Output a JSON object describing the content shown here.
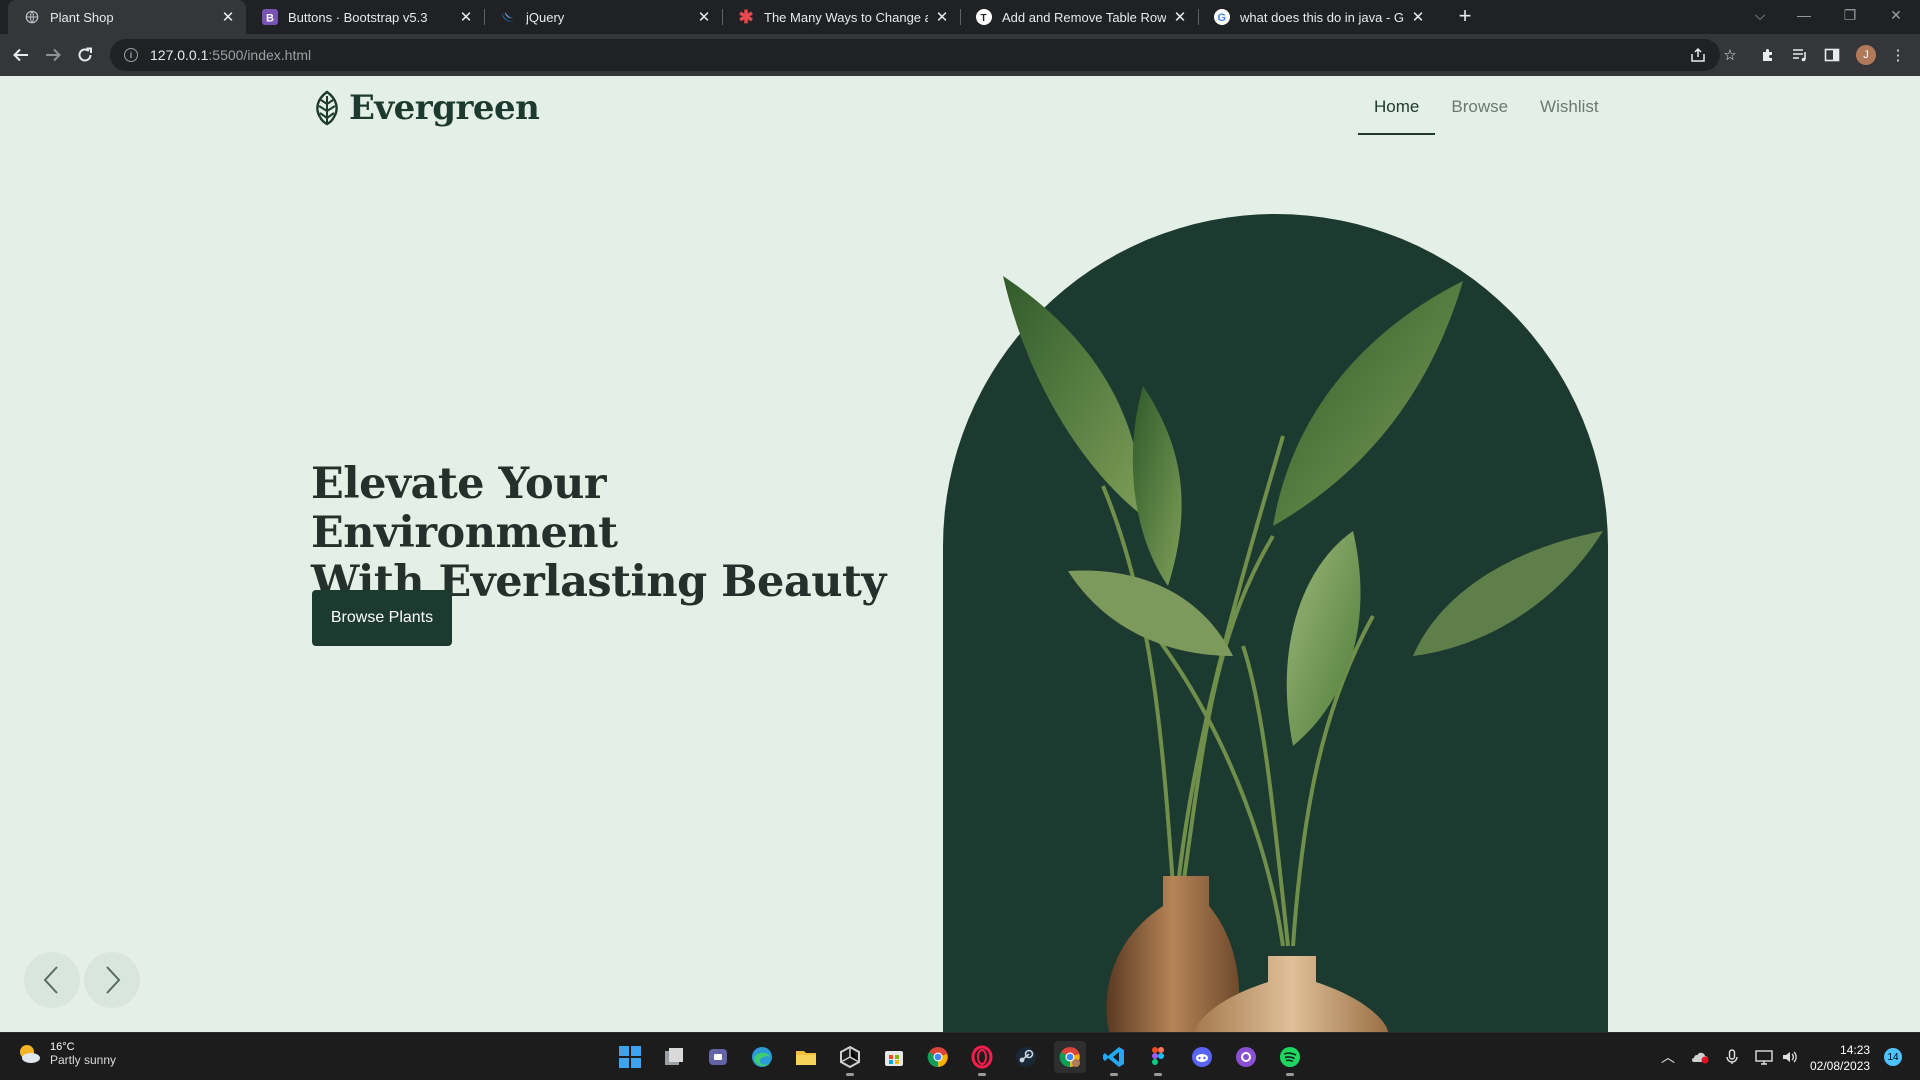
{
  "browser": {
    "tabs": [
      {
        "title": "Plant Shop",
        "icon": "globe-icon",
        "active": true
      },
      {
        "title": "Buttons · Bootstrap v5.3",
        "icon": "bootstrap-icon",
        "active": false
      },
      {
        "title": "jQuery",
        "icon": "jquery-icon",
        "active": false
      },
      {
        "title": "The Many Ways to Change an SV",
        "icon": "asterisk-icon",
        "active": false
      },
      {
        "title": "Add and Remove Table Rows Dy",
        "icon": "t-icon",
        "active": false
      },
      {
        "title": "what does this do in java - Goog",
        "icon": "google-icon",
        "active": false
      }
    ],
    "address": {
      "host": "127.0.0.1",
      "path": ":5500/index.html"
    },
    "profile_initial": "J"
  },
  "site": {
    "brand": "Evergreen",
    "nav": [
      {
        "label": "Home",
        "active": true
      },
      {
        "label": "Browse",
        "active": false
      },
      {
        "label": "Wishlist",
        "active": false
      }
    ],
    "hero": {
      "title_line1": "Elevate Your Environment",
      "title_line2": "With Everlasting Beauty",
      "cta_label": "Browse Plants"
    },
    "colors": {
      "background": "#e4efe7",
      "primary": "#1c3a2f",
      "text": "#23302b"
    }
  },
  "taskbar": {
    "weather": {
      "temp": "16°C",
      "condition": "Partly sunny"
    },
    "apps": [
      "start",
      "task-view",
      "teams",
      "edge",
      "file-explorer",
      "unity",
      "store",
      "chrome",
      "opera",
      "steam",
      "chrome-active",
      "vscode",
      "figma",
      "discord",
      "github-desktop",
      "spotify"
    ],
    "clock": {
      "time": "14:23",
      "date": "02/08/2023"
    },
    "notifications": "14"
  }
}
